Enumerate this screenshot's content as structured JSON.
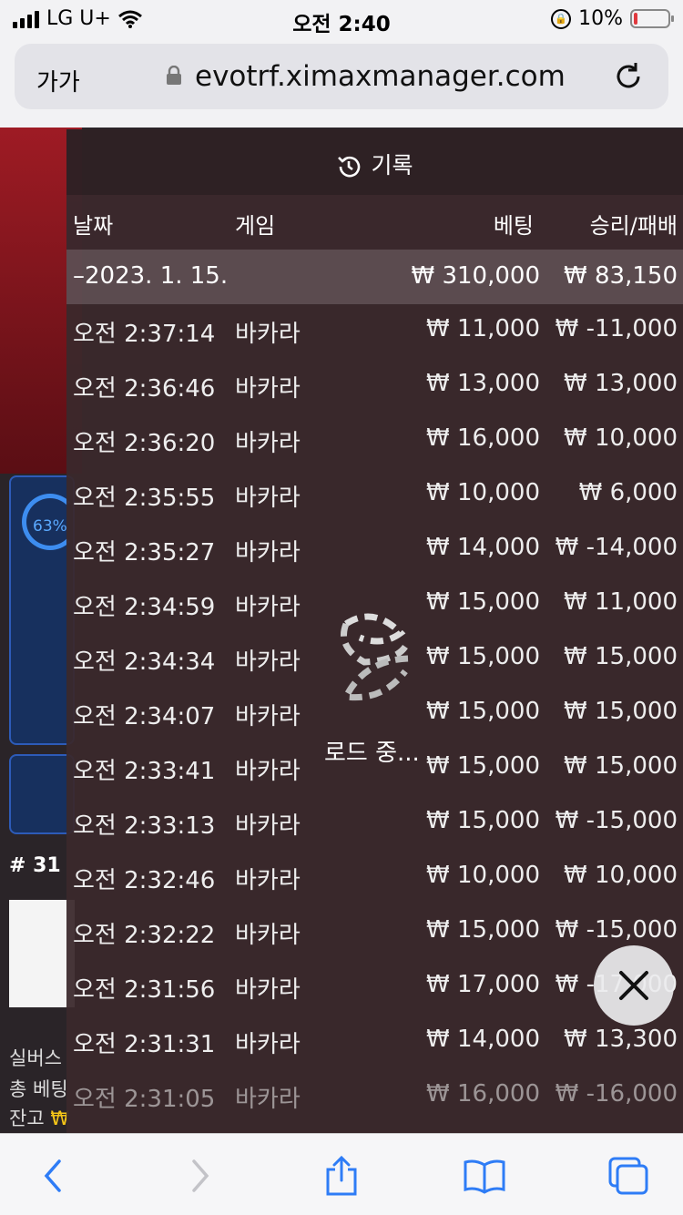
{
  "status": {
    "carrier": "LG U+",
    "time": "오전 2:40",
    "battery": "10%",
    "battery_level": 0.1
  },
  "browser": {
    "aa_label": "가가",
    "url": "evotrf.ximaxmanager.com"
  },
  "background": {
    "progress_label": "63%",
    "progress_value": 0.63,
    "table_number": "# 31",
    "line1": "실버스",
    "line2": "총 베팅",
    "line3_prefix": "잔고",
    "line3_currency": "₩"
  },
  "history": {
    "title": "기록",
    "columns": {
      "date": "날짜",
      "game": "게임",
      "bet": "베팅",
      "win_loss": "승리/패배"
    },
    "summary": {
      "date": "–2023. 1. 15.",
      "bet": "₩ 310,000",
      "win_loss": "₩ 83,150"
    },
    "rows": [
      {
        "time": "오전 2:37:14",
        "game": "바카라",
        "bet": "₩ 11,000",
        "win_loss": "₩ -11,000"
      },
      {
        "time": "오전 2:36:46",
        "game": "바카라",
        "bet": "₩ 13,000",
        "win_loss": "₩ 13,000"
      },
      {
        "time": "오전 2:36:20",
        "game": "바카라",
        "bet": "₩ 16,000",
        "win_loss": "₩ 10,000"
      },
      {
        "time": "오전 2:35:55",
        "game": "바카라",
        "bet": "₩ 10,000",
        "win_loss": "₩ 6,000"
      },
      {
        "time": "오전 2:35:27",
        "game": "바카라",
        "bet": "₩ 14,000",
        "win_loss": "₩ -14,000"
      },
      {
        "time": "오전 2:34:59",
        "game": "바카라",
        "bet": "₩ 15,000",
        "win_loss": "₩ 11,000"
      },
      {
        "time": "오전 2:34:34",
        "game": "바카라",
        "bet": "₩ 15,000",
        "win_loss": "₩ 15,000"
      },
      {
        "time": "오전 2:34:07",
        "game": "바카라",
        "bet": "₩ 15,000",
        "win_loss": "₩ 15,000"
      },
      {
        "time": "오전 2:33:41",
        "game": "바카라",
        "bet": "₩ 15,000",
        "win_loss": "₩ 15,000"
      },
      {
        "time": "오전 2:33:13",
        "game": "바카라",
        "bet": "₩ 15,000",
        "win_loss": "₩ -15,000"
      },
      {
        "time": "오전 2:32:46",
        "game": "바카라",
        "bet": "₩ 10,000",
        "win_loss": "₩ 10,000"
      },
      {
        "time": "오전 2:32:22",
        "game": "바카라",
        "bet": "₩ 15,000",
        "win_loss": "₩ -15,000"
      },
      {
        "time": "오전 2:31:56",
        "game": "바카라",
        "bet": "₩ 17,000",
        "win_loss": "₩ -17,000"
      },
      {
        "time": "오전 2:31:31",
        "game": "바카라",
        "bet": "₩ 14,000",
        "win_loss": "₩ 13,300"
      },
      {
        "time": "오전 2:31:05",
        "game": "바카라",
        "bet": "₩ 16,000",
        "win_loss": "₩ -16,000"
      }
    ]
  },
  "loading": {
    "text": "로드 중..."
  },
  "colors": {
    "accent_blue": "#2e7cf6",
    "battery_red": "#e0393e",
    "panel_bg": "#3a282c"
  },
  "icons": {
    "history": "history-clock-icon",
    "close": "close-icon",
    "back": "chevron-left-icon",
    "forward": "chevron-right-icon",
    "share": "share-icon",
    "bookmarks": "book-icon",
    "tabs": "tabs-icon"
  }
}
